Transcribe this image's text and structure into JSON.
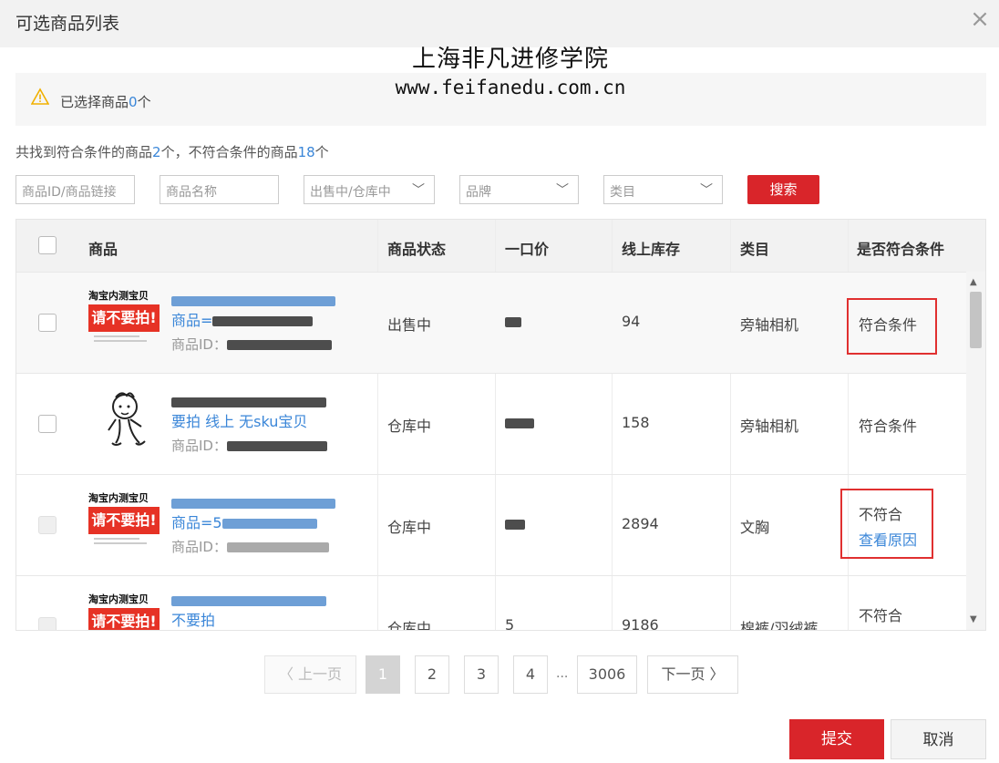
{
  "dialog": {
    "title": "可选商品列表",
    "close_icon": "×"
  },
  "watermark": {
    "line1": "上海非凡进修学院",
    "line2": "www.feifanedu.com.cn"
  },
  "notice": {
    "icon": "warning-icon",
    "prefix": "已选择商品",
    "count": "0",
    "suffix": "个"
  },
  "summary": {
    "text1": "共找到符合条件的商品",
    "match_count": "2",
    "text2": "个，不符合条件的商品",
    "nomatch_count": "18",
    "text3": "个"
  },
  "filters": {
    "id_placeholder": "商品ID/商品链接",
    "name_placeholder": "商品名称",
    "status_value": "出售中/仓库中",
    "brand_value": "品牌",
    "category_value": "类目",
    "search_label": "搜索"
  },
  "table": {
    "headers": [
      "商品",
      "商品状态",
      "一口价",
      "线上库存",
      "类目",
      "是否符合条件"
    ],
    "rows": [
      {
        "thumb_top": "淘宝内测宝贝",
        "thumb_banner": "请不要拍!",
        "name_line2": "商品=",
        "id_label": "商品ID：",
        "status": "出售中",
        "stock": "94",
        "category": "旁轴相机",
        "eligibility": "符合条件",
        "reason_link": ""
      },
      {
        "thumb_top": "",
        "thumb_banner": "",
        "name_line2": "要拍 线上 无sku宝贝",
        "id_label": "商品ID：",
        "status": "仓库中",
        "stock": "158",
        "category": "旁轴相机",
        "eligibility": "符合条件",
        "reason_link": ""
      },
      {
        "thumb_top": "淘宝内测宝贝",
        "thumb_banner": "请不要拍!",
        "name_line2": "商品=5",
        "id_label": "商品ID：",
        "status": "仓库中",
        "stock": "2894",
        "category": "文胸",
        "eligibility": "不符合",
        "reason_link": "查看原因"
      },
      {
        "thumb_top": "淘宝内测宝贝",
        "thumb_banner": "请不要拍!",
        "name_line2": "不要拍",
        "id_label": "",
        "status": "仓库中",
        "price": "5",
        "stock": "9186",
        "category": "棉裤/羽绒裤",
        "eligibility": "不符合",
        "reason_link": ""
      }
    ]
  },
  "pagination": {
    "prev": "上一页",
    "next": "下一页",
    "pages": [
      "1",
      "2",
      "3",
      "4"
    ],
    "ellipsis": "...",
    "last": "3006",
    "current": "1"
  },
  "footer": {
    "submit": "提交",
    "cancel": "取消"
  },
  "colors": {
    "accent_red": "#d9252a",
    "link_blue": "#3a86d8",
    "highlight_box": "#e03030"
  }
}
